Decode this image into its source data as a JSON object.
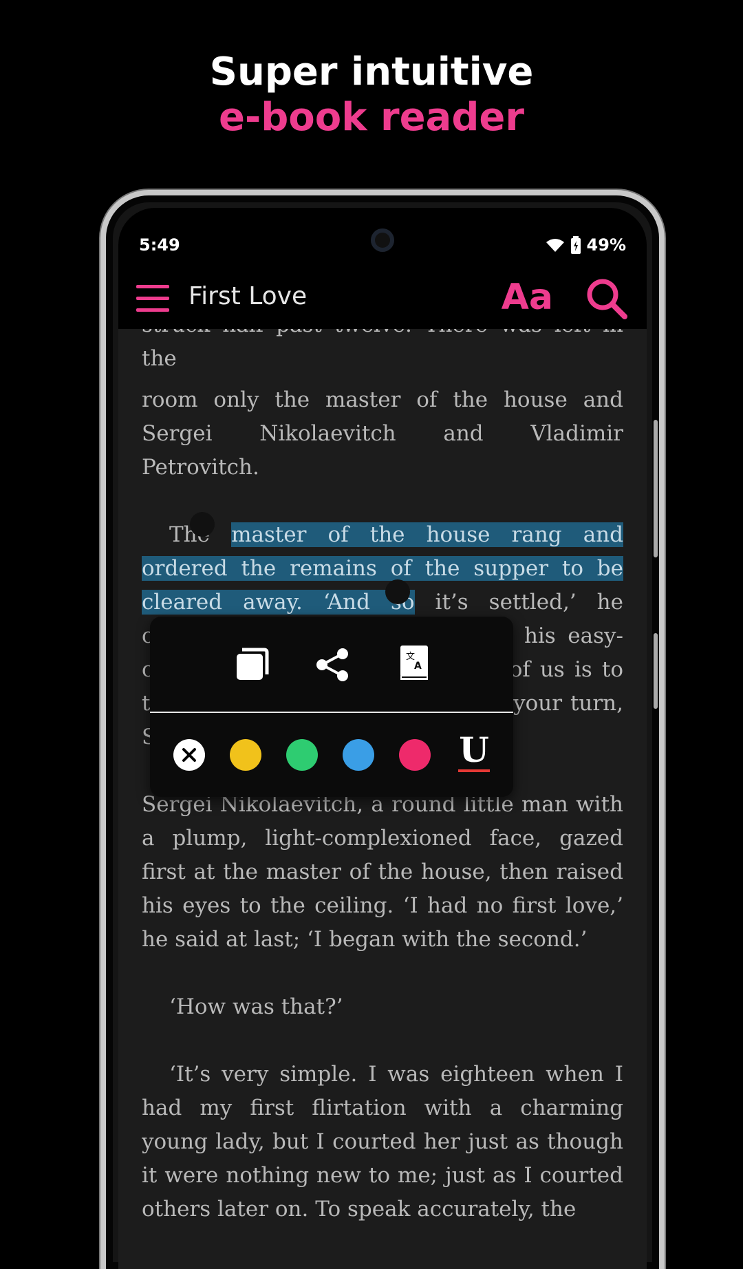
{
  "headline": {
    "line1": "Super intuitive",
    "line2": "e-book reader"
  },
  "status_bar": {
    "time": "5:49",
    "battery": "49%"
  },
  "app_bar": {
    "title": "First Love",
    "font_button_label": "Aa",
    "icons": [
      "menu-icon",
      "font-icon",
      "search-icon"
    ]
  },
  "reader": {
    "cut_line": "struck half past twelve. There was left in the",
    "p1": "room only the master of the house and Sergei Nikolaevitch and Vladimir Petrovitch.",
    "p2_pre": "The ",
    "p2_selected": "master of the house rang and ordered the remains of the supper to be cleared away. ‘And so",
    "p2_post": " it’s settled,’ he observed, sitting back farther in his easy-chair and lighting a cigar, ‘each of us is to tell the story of his first love. It’s your turn, Sergei Nikolaevitch.’",
    "p3": "Sergei Nikolaevitch, a round little man with a plump, light-complexioned face, gazed first at the master of the house, then raised his eyes to the ceiling. ‘I had no first love,’ he said at last; ‘I began with the second.’",
    "p4": "‘How was that?’",
    "p5": "‘It’s very simple. I was eighteen when I had my first flirtation with a charming young lady, but I courted her just as though it were nothing new to me; just as I courted others later on. To speak accurately, the"
  },
  "selection_popup": {
    "actions": [
      "copy-icon",
      "share-icon",
      "translate-icon"
    ],
    "highlight_colors": {
      "yellow": "#f1c21b",
      "green": "#2ecc71",
      "blue": "#3a9ee6",
      "pink": "#ee2a6b"
    },
    "underline_label": "U",
    "underline_color": "#e53935"
  },
  "accent_color": "#ee3c8e"
}
